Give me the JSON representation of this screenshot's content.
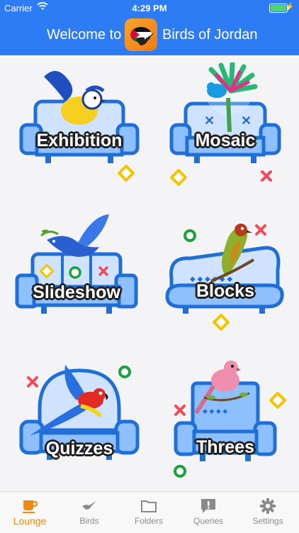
{
  "status_bar": {
    "carrier": "Carrier",
    "time": "4:29 PM"
  },
  "header": {
    "welcome_text": "Welcome to",
    "app_name": "Birds of Jordan"
  },
  "tiles": [
    {
      "label": "Exhibition"
    },
    {
      "label": "Mosaic"
    },
    {
      "label": "Slideshow"
    },
    {
      "label": "Blocks"
    },
    {
      "label": "Quizzes"
    },
    {
      "label": "Threes"
    }
  ],
  "tabs": [
    {
      "label": "Lounge",
      "icon": "coffee-cup-icon",
      "active": true
    },
    {
      "label": "Birds",
      "icon": "bird-icon",
      "active": false
    },
    {
      "label": "Folders",
      "icon": "folder-icon",
      "active": false
    },
    {
      "label": "Queries",
      "icon": "chat-exclamation-icon",
      "active": false
    },
    {
      "label": "Settings",
      "icon": "gear-icon",
      "active": false
    }
  ],
  "colors": {
    "nav_blue": "#2d7cf6",
    "accent_orange": "#ef8a10",
    "sofa_blue": "#1f6fd6",
    "sofa_light": "#cfe3ff"
  }
}
